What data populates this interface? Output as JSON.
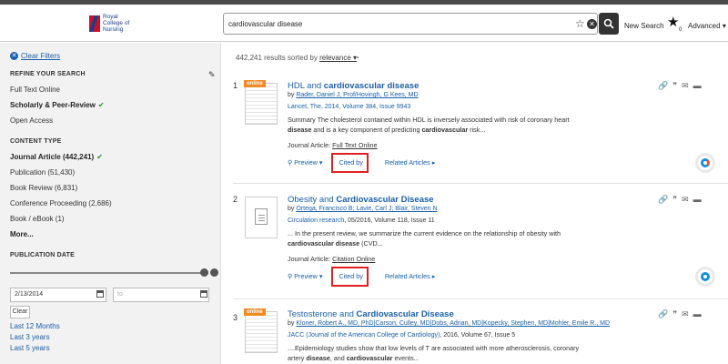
{
  "header": {
    "logo_text": "Royal College of Nursing",
    "search_value": "cardiovascular disease",
    "new_search": "New Search",
    "star_count": "0",
    "advanced": "Advanced"
  },
  "sidebar": {
    "clear_filters": "Clear Filters",
    "refine_title": "REFINE YOUR SEARCH",
    "refine_items": [
      "Full Text Online",
      "Scholarly & Peer-Review",
      "Open Access"
    ],
    "content_type_title": "CONTENT TYPE",
    "content_items": [
      "Journal Article (442,241)",
      "Publication (51,430)",
      "Book Review (6,831)",
      "Conference Proceeding (2,686)",
      "Book / eBook (1)",
      "More..."
    ],
    "pub_date_title": "PUBLICATION DATE",
    "date_from": "2/13/2014",
    "date_to_placeholder": "to",
    "clear_label": "Clear",
    "quick_links": [
      "Last 12 Months",
      "Last 3 years",
      "Last 5 years"
    ]
  },
  "main": {
    "results_count": "442,241 results sorted by",
    "sort_label": "relevance",
    "results": [
      {
        "num": "1",
        "badge": "online",
        "title_plain": "HDL and ",
        "title_bold": "cardiovascular disease",
        "authors": "Rader, Daniel J, Prof/Hovingh, G Kees, MD",
        "source": "Lancet, The, 2014, Volume 384, Issue 9943",
        "summary_1": "Summary The cholesterol contained within HDL is inversely associated with risk of coronary heart",
        "summary_2b": "disease",
        "summary_2": " and is a key component of predicting ",
        "summary_2c": "cardiovascular",
        "summary_2d": " risk...",
        "type_label": "Journal Article:",
        "type_link": "Full Text Online",
        "preview": "Preview",
        "cited_by": "Cited by",
        "related": "Related Articles"
      },
      {
        "num": "2",
        "title_plain": "Obesity and ",
        "title_bold": "Cardiovascular Disease",
        "authors": "Ortega, Francisco B; Lavie, Carl J; Blair, Steven N",
        "source_link": "Circulation research",
        "source_rest": ", 05/2016, Volume 118, Issue 11",
        "summary_1": "... In the present review, we summarize the current evidence on the relationship of obesity with",
        "summary_2b": "cardiovascular disease",
        "summary_2": " (CVD...",
        "type_label": "Journal Article:",
        "type_link": "Citation Online",
        "preview": "Preview",
        "cited_by": "Cited by",
        "related": "Related Articles"
      },
      {
        "num": "3",
        "badge": "online",
        "title_plain": "Testosterone and ",
        "title_bold": "Cardiovascular Disease",
        "authors": "Kloner, Robert A., MD, PhD|Carson, Culley, MD|Dobs, Adrian, MD|Kopecky, Stephen, MD|Mohler, Emile R., MD",
        "source_link": "JACC (Journal of the American College of Cardiology)",
        "source_rest": ", 2016, Volume 67, Issue 5",
        "summary_1": "....Epidemiology studies show that low levels of T are associated with more atherosclerosis, coronary",
        "summary_2a": "artery ",
        "summary_2b": "disease",
        "summary_2": ", and ",
        "summary_2c": "cardiovascular",
        "summary_2d": " events..."
      }
    ]
  },
  "colors": {
    "link": "#1a5fa8",
    "highlight_box": "#e02020",
    "online_badge": "#f08a24",
    "check": "#2e8b2e"
  },
  "icons": [
    "search-icon",
    "star-icon",
    "clear-icon",
    "pencil-icon",
    "rss-icon",
    "link-icon",
    "quote-icon",
    "email-icon",
    "folder-icon",
    "calendar-icon"
  ]
}
